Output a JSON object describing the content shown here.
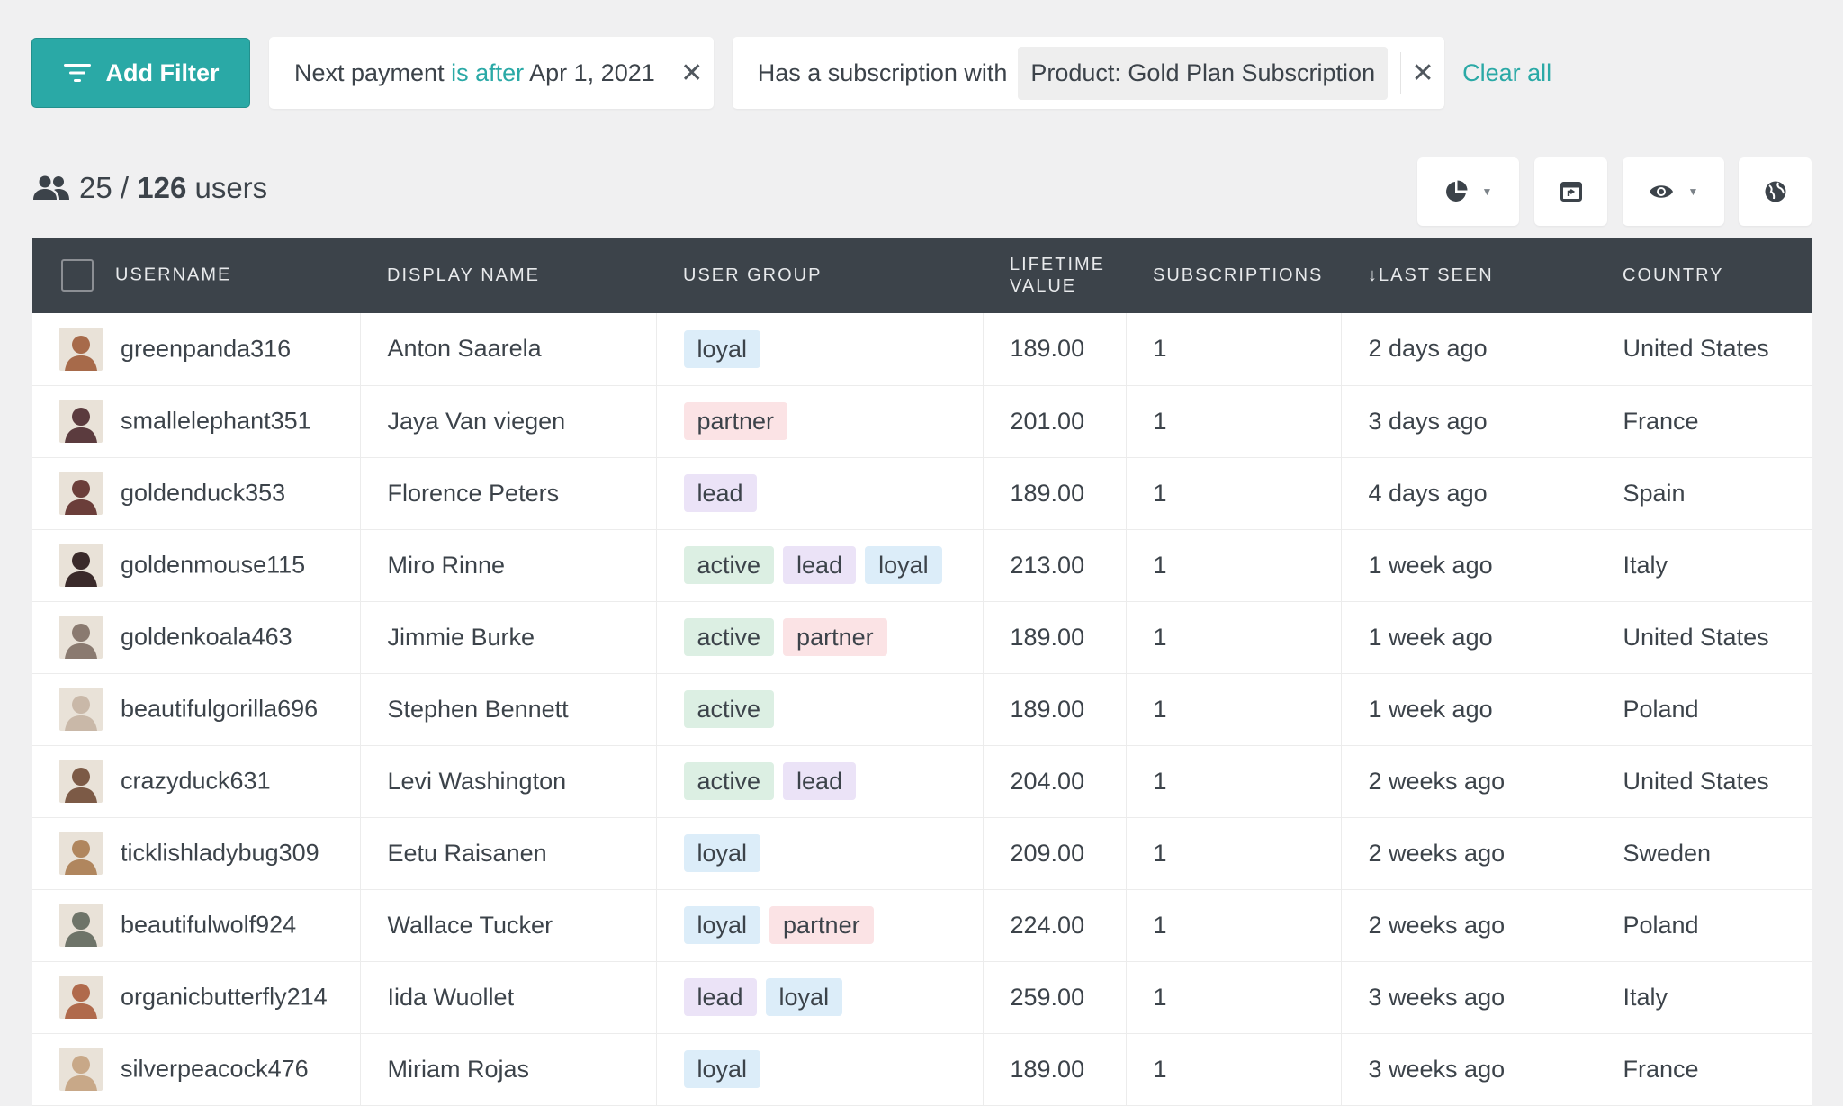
{
  "filters": {
    "add_label": "Add Filter",
    "chips": [
      {
        "prefix": "Next payment",
        "operator": "is after",
        "value": "Apr 1, 2021",
        "close": "✕"
      },
      {
        "prefix": "Has a subscription with",
        "pill": "Product: Gold Plan Subscription",
        "close": "✕"
      }
    ],
    "clear_all": "Clear all"
  },
  "count": {
    "shown": "25",
    "sep": "/",
    "total": "126",
    "suffix": "users"
  },
  "toolbar": {
    "icons": [
      "pie-chart-icon",
      "layout-icon",
      "eye-icon",
      "globe-icon"
    ]
  },
  "table": {
    "columns": [
      "USERNAME",
      "DISPLAY NAME",
      "USER GROUP",
      "LIFETIME VALUE",
      "SUBSCRIPTIONS",
      "↓LAST SEEN",
      "COUNTRY"
    ],
    "rows": [
      {
        "username": "greenpanda316",
        "display": "Anton Saarela",
        "groups": [
          "loyal"
        ],
        "value": "189.00",
        "subs": "1",
        "seen": "2 days ago",
        "country": "United States",
        "av": "#a76a4a"
      },
      {
        "username": "smallelephant351",
        "display": "Jaya Van viegen",
        "groups": [
          "partner"
        ],
        "value": "201.00",
        "subs": "1",
        "seen": "3 days ago",
        "country": "France",
        "av": "#5b3b3e"
      },
      {
        "username": "goldenduck353",
        "display": "Florence Peters",
        "groups": [
          "lead"
        ],
        "value": "189.00",
        "subs": "1",
        "seen": "4 days ago",
        "country": "Spain",
        "av": "#6b3e3a"
      },
      {
        "username": "goldenmouse115",
        "display": "Miro Rinne",
        "groups": [
          "active",
          "lead",
          "loyal"
        ],
        "value": "213.00",
        "subs": "1",
        "seen": "1 week ago",
        "country": "Italy",
        "av": "#3a2a2a"
      },
      {
        "username": "goldenkoala463",
        "display": "Jimmie Burke",
        "groups": [
          "active",
          "partner"
        ],
        "value": "189.00",
        "subs": "1",
        "seen": "1 week ago",
        "country": "United States",
        "av": "#8a7a70"
      },
      {
        "username": "beautifulgorilla696",
        "display": "Stephen Bennett",
        "groups": [
          "active"
        ],
        "value": "189.00",
        "subs": "1",
        "seen": "1 week ago",
        "country": "Poland",
        "av": "#c9b8a8"
      },
      {
        "username": "crazyduck631",
        "display": "Levi Washington",
        "groups": [
          "active",
          "lead"
        ],
        "value": "204.00",
        "subs": "1",
        "seen": "2 weeks ago",
        "country": "United States",
        "av": "#7c5a46"
      },
      {
        "username": "ticklishladybug309",
        "display": "Eetu Raisanen",
        "groups": [
          "loyal"
        ],
        "value": "209.00",
        "subs": "1",
        "seen": "2 weeks ago",
        "country": "Sweden",
        "av": "#b0865e"
      },
      {
        "username": "beautifulwolf924",
        "display": "Wallace Tucker",
        "groups": [
          "loyal",
          "partner"
        ],
        "value": "224.00",
        "subs": "1",
        "seen": "2 weeks ago",
        "country": "Poland",
        "av": "#6e7469"
      },
      {
        "username": "organicbutterfly214",
        "display": "Iida Wuollet",
        "groups": [
          "lead",
          "loyal"
        ],
        "value": "259.00",
        "subs": "1",
        "seen": "3 weeks ago",
        "country": "Italy",
        "av": "#b06a4c"
      },
      {
        "username": "silverpeacock476",
        "display": "Miriam Rojas",
        "groups": [
          "loyal"
        ],
        "value": "189.00",
        "subs": "1",
        "seen": "3 weeks ago",
        "country": "France",
        "av": "#c8a888"
      }
    ]
  }
}
